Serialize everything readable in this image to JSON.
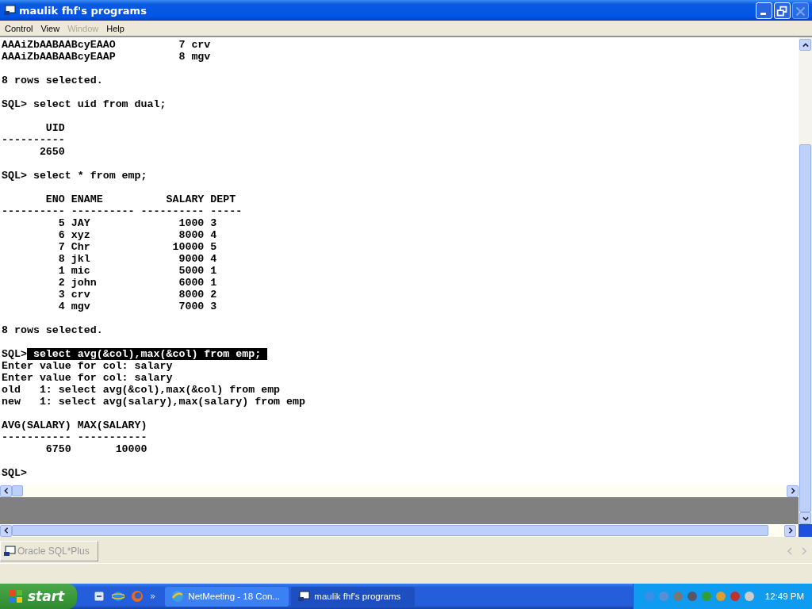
{
  "window": {
    "title": "maulik fhf's programs",
    "close_disabled": true
  },
  "menu": [
    {
      "label": "Control",
      "disabled": false
    },
    {
      "label": "View",
      "disabled": false
    },
    {
      "label": "Window",
      "disabled": true
    },
    {
      "label": "Help",
      "disabled": false
    }
  ],
  "console": {
    "lines": [
      {
        "kind": "text",
        "text": "AAAiZbAABAABcyEAAO          7 crv"
      },
      {
        "kind": "text",
        "text": "AAAiZbAABAABcyEAAP          8 mgv"
      },
      {
        "kind": "blank"
      },
      {
        "kind": "text",
        "text": "8 rows selected."
      },
      {
        "kind": "blank"
      },
      {
        "kind": "text",
        "text": "SQL> select uid from dual;"
      },
      {
        "kind": "blank"
      },
      {
        "kind": "text",
        "text": "       UID"
      },
      {
        "kind": "text",
        "text": "----------"
      },
      {
        "kind": "text",
        "text": "      2650"
      },
      {
        "kind": "blank"
      },
      {
        "kind": "text",
        "text": "SQL> select * from emp;"
      },
      {
        "kind": "blank"
      },
      {
        "kind": "text",
        "text": "       ENO ENAME          SALARY DEPT"
      },
      {
        "kind": "text",
        "text": "---------- ---------- ---------- -----"
      },
      {
        "kind": "text",
        "text": "         5 JAY              1000 3"
      },
      {
        "kind": "text",
        "text": "         6 xyz              8000 4"
      },
      {
        "kind": "text",
        "text": "         7 Chr             10000 5"
      },
      {
        "kind": "text",
        "text": "         8 jkl              9000 4"
      },
      {
        "kind": "text",
        "text": "         1 mic              5000 1"
      },
      {
        "kind": "text",
        "text": "         2 john             6000 1"
      },
      {
        "kind": "text",
        "text": "         3 crv              8000 2"
      },
      {
        "kind": "text",
        "text": "         4 mgv              7000 3"
      },
      {
        "kind": "blank"
      },
      {
        "kind": "text",
        "text": "8 rows selected."
      },
      {
        "kind": "blank"
      },
      {
        "kind": "selection",
        "prompt": "SQL>",
        "text": " select avg(&col),max(&col) from emp; "
      },
      {
        "kind": "text",
        "text": "Enter value for col: salary"
      },
      {
        "kind": "text",
        "text": "Enter value for col: salary"
      },
      {
        "kind": "text",
        "text": "old   1: select avg(&col),max(&col) from emp"
      },
      {
        "kind": "text",
        "text": "new   1: select avg(salary),max(salary) from emp"
      },
      {
        "kind": "blank"
      },
      {
        "kind": "text",
        "text": "AVG(SALARY) MAX(SALARY)"
      },
      {
        "kind": "text",
        "text": "----------- -----------"
      },
      {
        "kind": "text",
        "text": "       6750       10000"
      },
      {
        "kind": "blank"
      },
      {
        "kind": "text",
        "text": "SQL>"
      }
    ]
  },
  "mdi_tabs": [
    {
      "label": "Oracle SQL*Plus",
      "disabled": true
    }
  ],
  "taskbar": {
    "start": "start",
    "overflow": "»",
    "tasks": [
      {
        "label": "NetMeeting - 18 Con...",
        "selected": false
      },
      {
        "label": "maulik fhf's programs",
        "selected": true
      }
    ],
    "clock": "12:49 PM"
  }
}
